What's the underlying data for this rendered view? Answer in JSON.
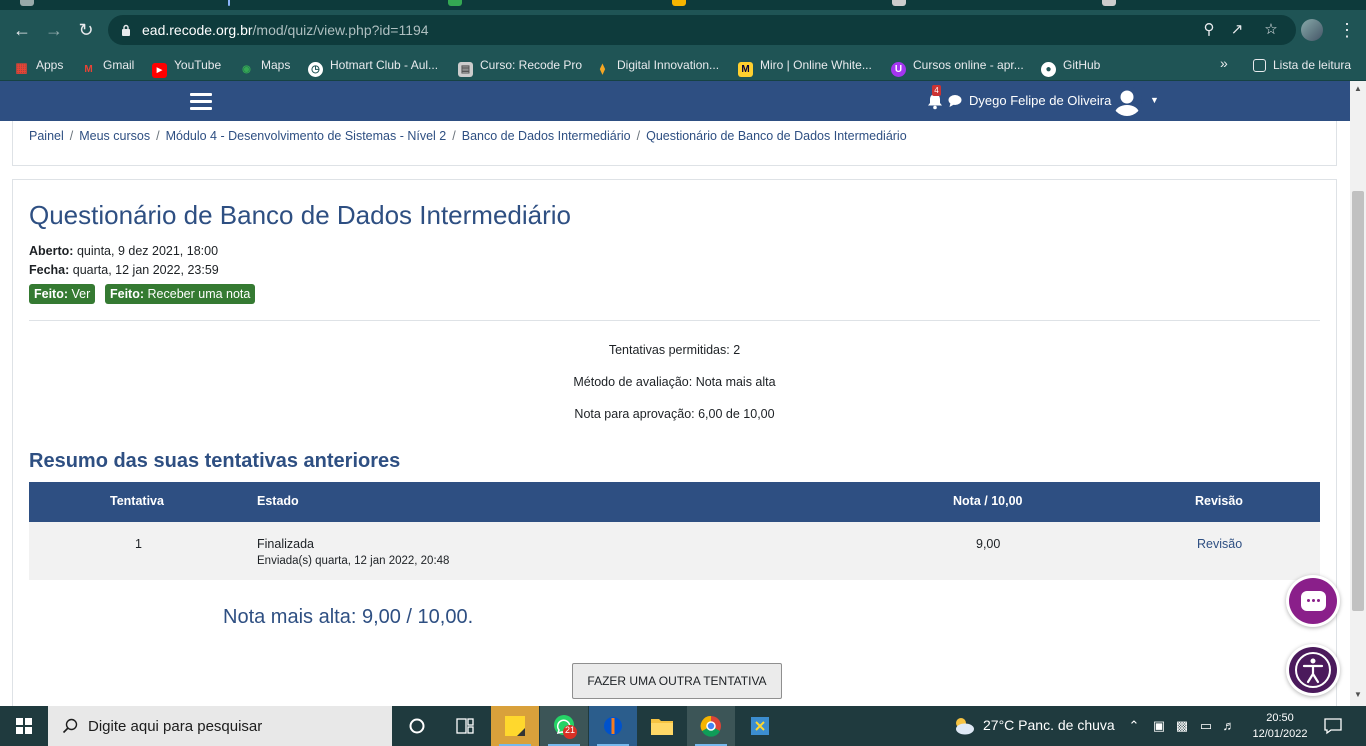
{
  "browser": {
    "url_host": "ead.recode.org.br",
    "url_path": "/mod/quiz/view.php?id=1194",
    "bookmarks": [
      {
        "label": "Apps",
        "icon": "apps-grid-icon",
        "color": "#ea4335"
      },
      {
        "label": "Gmail",
        "icon": "gmail-icon",
        "color": "#ea4335"
      },
      {
        "label": "YouTube",
        "icon": "youtube-icon",
        "color": "#ff0000"
      },
      {
        "label": "Maps",
        "icon": "maps-pin-icon",
        "color": "#34a853"
      },
      {
        "label": "Hotmart Club - Aul...",
        "icon": "globe-icon",
        "color": "#ffffff"
      },
      {
        "label": "Curso: Recode Pro",
        "icon": "page-icon",
        "color": "#cccccc"
      },
      {
        "label": "Digital Innovation...",
        "icon": "dio-icon",
        "color": "#f5a623"
      },
      {
        "label": "Miro | Online White...",
        "icon": "miro-icon",
        "color": "#ffd02f"
      },
      {
        "label": "Cursos online - apr...",
        "icon": "udemy-icon",
        "color": "#a435f0"
      },
      {
        "label": "GitHub",
        "icon": "github-icon",
        "color": "#ffffff"
      }
    ],
    "more_bookmarks": "»",
    "reading_list": "Lista de leitura"
  },
  "navbar": {
    "notification_count": "4",
    "user_name": "Dyego Felipe de Oliveira"
  },
  "breadcrumb": [
    "Painel",
    "Meus cursos",
    "Módulo 4 - Desenvolvimento de Sistemas - Nível 2",
    "Banco de Dados Intermediário",
    "Questionário de Banco de Dados Intermediário"
  ],
  "quiz": {
    "title": "Questionário de Banco de Dados Intermediário",
    "opened_label": "Aberto:",
    "opened_value": "quinta, 9 dez 2021, 18:00",
    "closes_label": "Fecha:",
    "closes_value": "quarta, 12 jan 2022, 23:59",
    "badges": [
      {
        "label": "Feito:",
        "value": "Ver"
      },
      {
        "label": "Feito:",
        "value": "Receber uma nota"
      }
    ],
    "attempts_allowed": "Tentativas permitidas: 2",
    "grading_method": "Método de avaliação: Nota mais alta",
    "pass_grade": "Nota para aprovação: 6,00 de 10,00",
    "summary_title": "Resumo das suas tentativas anteriores",
    "table": {
      "headers": [
        "Tentativa",
        "Estado",
        "Nota / 10,00",
        "Revisão"
      ],
      "rows": [
        {
          "attempt": "1",
          "state": "Finalizada",
          "submitted": "Enviada(s) quarta, 12 jan 2022, 20:48",
          "grade": "9,00",
          "review": "Revisão"
        }
      ]
    },
    "highest_grade": "Nota mais alta: 9,00 / 10,00.",
    "retry_button": "Fazer uma outra tentativa"
  },
  "taskbar": {
    "search_placeholder": "Digite aqui para pesquisar",
    "whatsapp_badge": "21",
    "weather": "27°C  Panc. de chuva",
    "time": "20:50",
    "date": "12/01/2022"
  },
  "colors": {
    "moodle_primary": "#2e4f82",
    "badge_green": "#357a32",
    "browser_frame": "#1f5455"
  }
}
